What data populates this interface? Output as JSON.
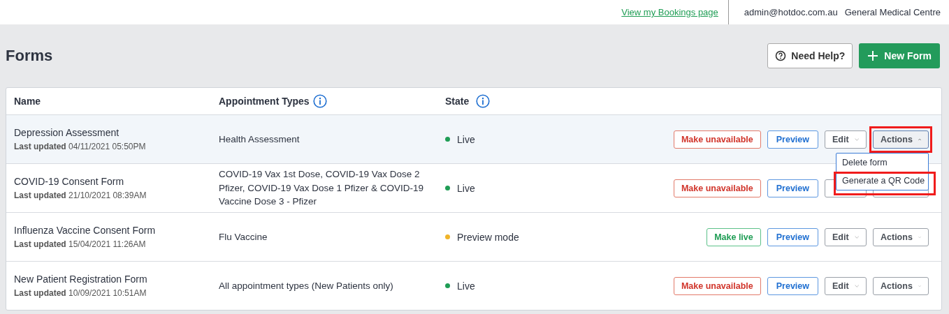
{
  "topbar": {
    "link": "View my Bookings page",
    "email": "admin@hotdoc.com.au",
    "clinic": "General Medical Centre"
  },
  "page": {
    "title": "Forms",
    "help_button": "Need Help?",
    "new_button": "New Form"
  },
  "table": {
    "columns": [
      "Name",
      "Appointment Types",
      "State"
    ],
    "rows": [
      {
        "name": "Depression Assessment",
        "updated_label": "Last updated",
        "updated": "04/11/2021 05:50PM",
        "types": "Health Assessment",
        "status": {
          "label": "Live",
          "kind": "live"
        },
        "toggle": {
          "label": "Make unavailable",
          "kind": "danger"
        },
        "preview": "Preview",
        "edit": "Edit",
        "actions": "Actions",
        "actions_open": true,
        "highlighted": true,
        "menu": [
          {
            "label": "Delete form",
            "highlighted": false
          },
          {
            "label": "Generate a QR Code",
            "highlighted": true
          }
        ]
      },
      {
        "name": "COVID-19 Consent Form",
        "updated_label": "Last updated",
        "updated": "21/10/2021 08:39AM",
        "types": "COVID-19 Vax 1st Dose, COVID-19 Vax Dose 2 Pfizer, COVID-19 Vax Dose 1 Pfizer & COVID-19 Vaccine Dose 3 - Pfizer",
        "status": {
          "label": "Live",
          "kind": "live"
        },
        "toggle": {
          "label": "Make unavailable",
          "kind": "danger"
        },
        "preview": "Preview",
        "actions_open": false,
        "highlighted": false
      },
      {
        "name": "Influenza Vaccine Consent Form",
        "updated_label": "Last updated",
        "updated": "15/04/2021 11:26AM",
        "types": "Flu Vaccine",
        "status": {
          "label": "Preview mode",
          "kind": "preview"
        },
        "toggle": {
          "label": "Make live",
          "kind": "success"
        },
        "preview": "Preview",
        "edit": "Edit",
        "actions": "Actions",
        "actions_open": false,
        "highlighted": false
      },
      {
        "name": "New Patient Registration Form",
        "updated_label": "Last updated",
        "updated": "10/09/2021 10:51AM",
        "types": "All appointment types (New Patients only)",
        "status": {
          "label": "Live",
          "kind": "live"
        },
        "toggle": {
          "label": "Make unavailable",
          "kind": "danger"
        },
        "preview": "Preview",
        "edit": "Edit",
        "actions": "Actions",
        "actions_open": false,
        "highlighted": false
      }
    ]
  }
}
